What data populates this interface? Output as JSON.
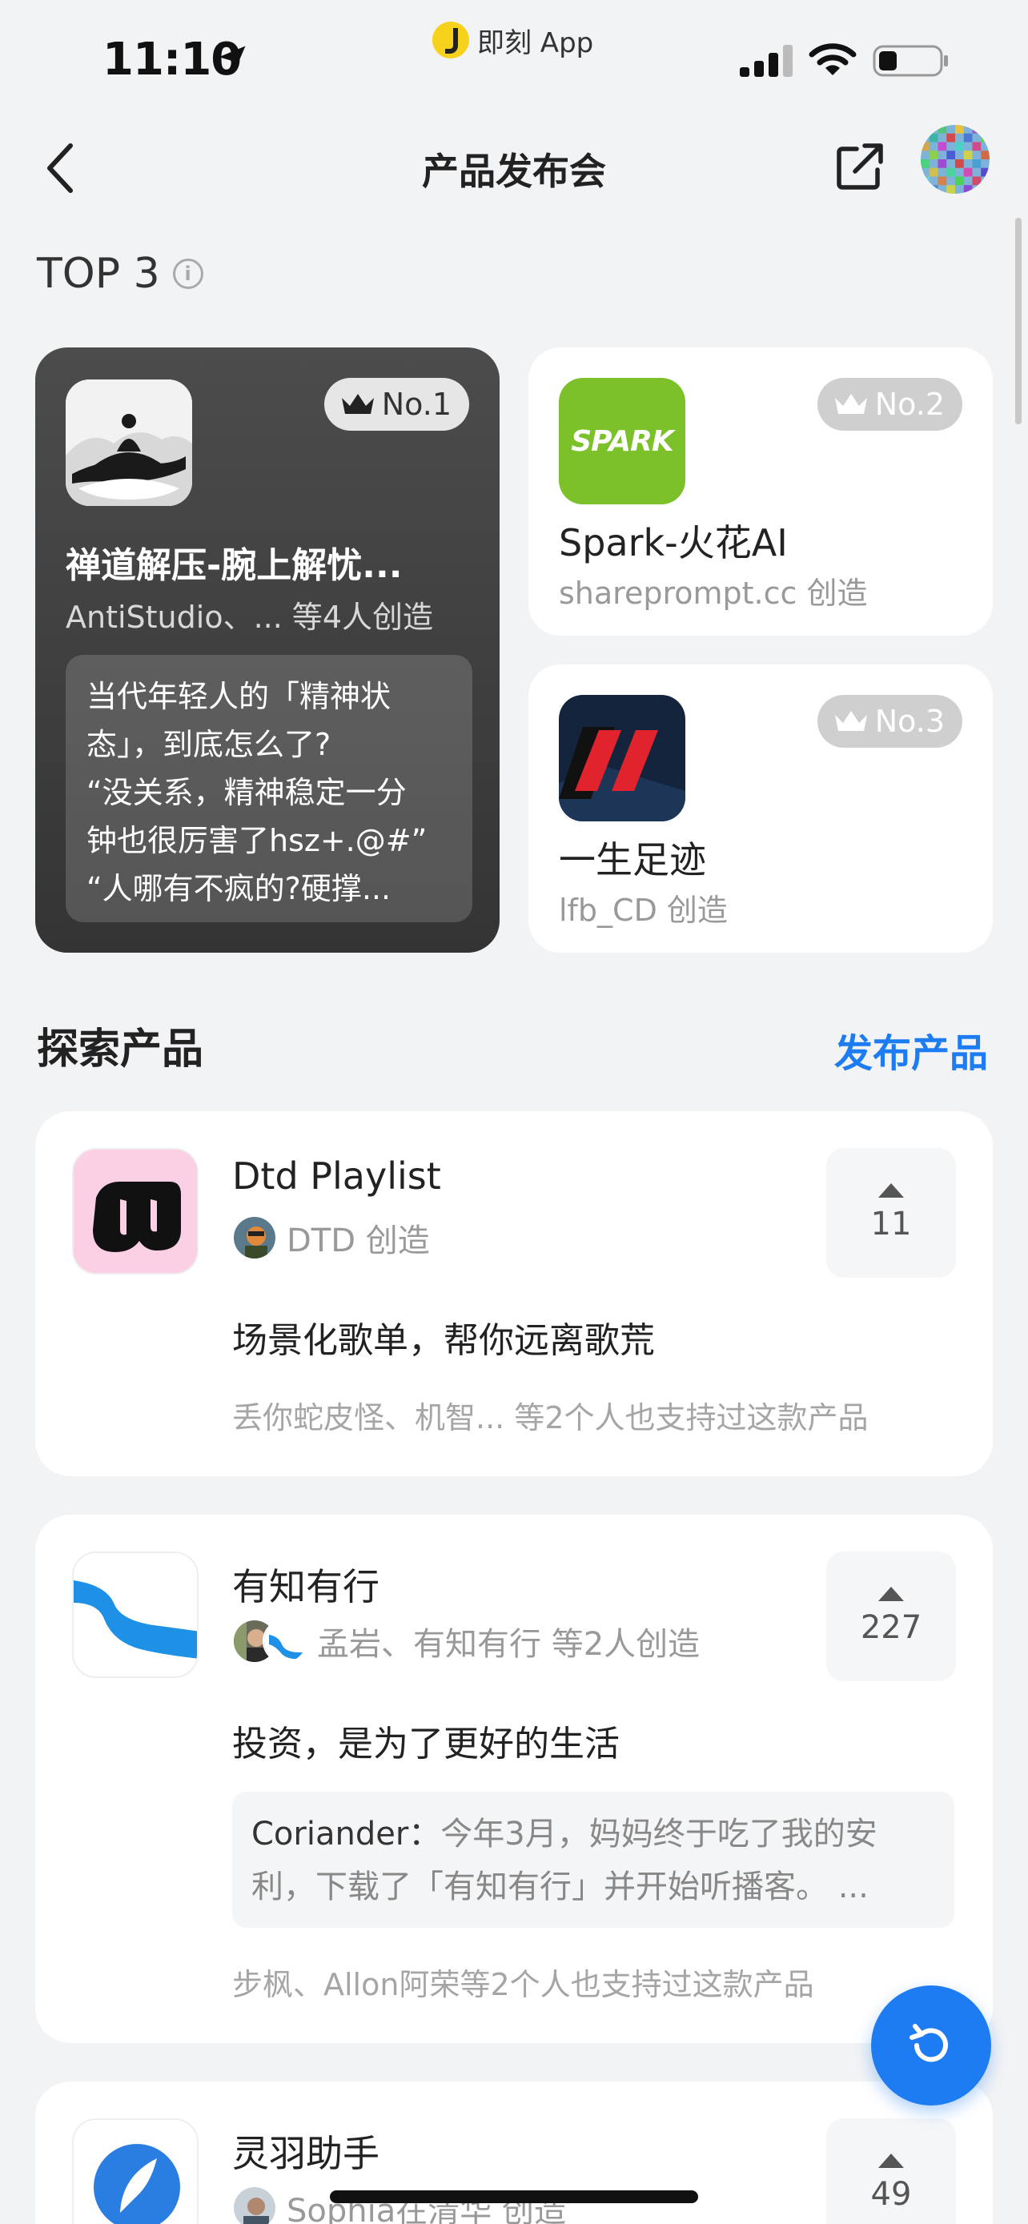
{
  "status_bar": {
    "time": "11:10",
    "app_label": "即刻 App"
  },
  "nav": {
    "title": "产品发布会"
  },
  "top3": {
    "title": "TOP 3",
    "info_glyph": "i",
    "items": [
      {
        "rank": "No.1",
        "name": "禅道解压-腕上解忧...",
        "creator": "AntiStudio、... 等4人创造",
        "quote_lines": [
          "当代年轻人的「精神状",
          "态」，到底怎么了?",
          "“没关系，精神稳定一分",
          "钟也很厉害了hsz+.@#”",
          "“人哪有不疯的?硬撑..."
        ]
      },
      {
        "rank": "No.2",
        "name": "Spark-火花AI",
        "creator": "shareprompt.cc 创造",
        "icon_text": "SPARK"
      },
      {
        "rank": "No.3",
        "name": "一生足迹",
        "creator": "lfb_CD 创造"
      }
    ]
  },
  "explore": {
    "title": "探索产品",
    "publish_label": "发布产品",
    "products": [
      {
        "name": "Dtd Playlist",
        "byline": "DTD 创造",
        "upvotes": "11",
        "tagline": "场景化歌单，帮你远离歌荒",
        "supporters": "丢你蛇皮怪、机智... 等2个人也支持过这款产品"
      },
      {
        "name": "有知有行",
        "byline": "孟岩、有知有行 等2人创造",
        "upvotes": "227",
        "tagline": "投资，是为了更好的生活",
        "comment_author": "Coriander：",
        "comment_text": "今年3月，妈妈终于吃了我的安利，下载了「有知有行」并开始听播客。 ...",
        "supporters": "步枫、Allon阿荣等2个人也支持过这款产品"
      },
      {
        "name": "灵羽助手",
        "byline": "Sophia在清华 创造",
        "upvotes": "49"
      }
    ]
  },
  "colors": {
    "accent": "#1e7cf2",
    "page_bg": "#f2f3f5",
    "top1_card": "#3f3f3f",
    "spark_green": "#7cc12a"
  },
  "icons": [
    "location-arrow-icon",
    "signal-icon",
    "wifi-icon",
    "battery-icon",
    "back-icon",
    "share-icon",
    "crown-icon",
    "info-icon",
    "upvote-icon",
    "refresh-icon"
  ]
}
